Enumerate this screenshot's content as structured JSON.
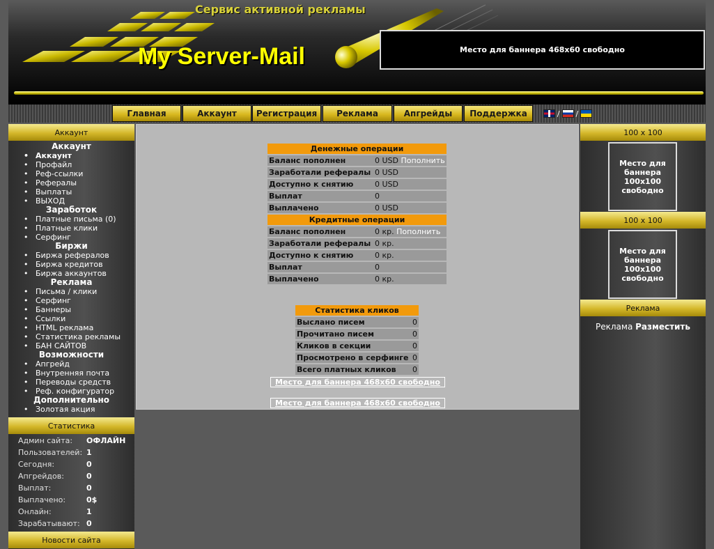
{
  "header": {
    "slogan": "Сервис активной рекламы",
    "site_title": "My Server-Mail",
    "banner_text": "Место для баннера 468х60 свободно"
  },
  "nav": {
    "items": [
      "Главная",
      "Аккаунт",
      "Регистрация",
      "Реклама",
      "Апгрейды",
      "Поддержка"
    ],
    "flag_separator": "/"
  },
  "left": {
    "account_title": "Аккаунт",
    "menu": [
      {
        "section": "Аккаунт",
        "items": [
          "Аккаунт",
          "Профайл",
          "Реф-ссылки",
          "Рефералы",
          "Выплаты",
          "ВЫХОД"
        ]
      },
      {
        "section": "Заработок",
        "items": [
          "Платные письма (0)",
          "Платные клики",
          "Серфинг"
        ]
      },
      {
        "section": "Биржи",
        "items": [
          "Биржа рефералов",
          "Биржа кредитов",
          "Биржа аккаунтов"
        ]
      },
      {
        "section": "Реклама",
        "items": [
          "Письма / клики",
          "Серфинг",
          "Баннеры",
          "Ссылки",
          "HTML реклама",
          "Статистика рекламы",
          "БАН САЙТОВ"
        ]
      },
      {
        "section": "Возможности",
        "items": [
          "Апгрейд",
          "Внутренняя почта",
          "Переводы средств",
          "Реф. конфигуратор"
        ]
      },
      {
        "section": "Дополнительно",
        "items": [
          "Золотая акция"
        ]
      }
    ],
    "stats_title": "Статистика",
    "stats": [
      {
        "label": "Админ сайта:",
        "value": "ОФЛАЙН"
      },
      {
        "label": "Пользователей:",
        "value": "1"
      },
      {
        "label": "Сегодня:",
        "value": "0"
      },
      {
        "label": "Апгрейдов:",
        "value": "0"
      },
      {
        "label": "Выплат:",
        "value": "0"
      },
      {
        "label": "Выплачено:",
        "value": "0$"
      },
      {
        "label": "Онлайн:",
        "value": "1"
      },
      {
        "label": "Зарабатывают:",
        "value": "0"
      }
    ],
    "news_title": "Новости сайта"
  },
  "money": {
    "title": "Денежные операции",
    "rows": [
      {
        "label": "Баланс пополнен",
        "value": "0 USD",
        "link": "Пополнить"
      },
      {
        "label": "Заработали рефералы",
        "value": "0 USD"
      },
      {
        "label": "Доступно к снятию",
        "value": "0 USD"
      },
      {
        "label": "Выплат",
        "value": "0"
      },
      {
        "label": "Выплачено",
        "value": "0 USD"
      }
    ]
  },
  "credit": {
    "title": "Кредитные операции",
    "rows": [
      {
        "label": "Баланс пополнен",
        "value": "0 кр.",
        "link": "Пополнить"
      },
      {
        "label": "Заработали рефералы",
        "value": "0 кр."
      },
      {
        "label": "Доступно к снятию",
        "value": "0 кр."
      },
      {
        "label": "Выплат",
        "value": "0"
      },
      {
        "label": "Выплачено",
        "value": "0 кр."
      }
    ]
  },
  "clicks": {
    "title": "Статистика кликов",
    "rows": [
      {
        "label": "Выслано писем",
        "value": "0"
      },
      {
        "label": "Прочитано писем",
        "value": "0"
      },
      {
        "label": "Кликов в секции",
        "value": "0"
      },
      {
        "label": "Просмотрено в серфинге",
        "value": "0"
      },
      {
        "label": "Всего платных кликов",
        "value": "0"
      }
    ]
  },
  "main_banners": [
    "Место для баннера 468х60 свободно",
    "Место для баннера 468х60 свободно"
  ],
  "right": {
    "blocks": [
      {
        "title": "100 x 100",
        "text": "Место для баннера 100х100 свободно"
      },
      {
        "title": "100 x 100",
        "text": "Место для баннера 100х100 свободно"
      }
    ],
    "ad_title": "Реклама",
    "ad_text": "Реклама",
    "ad_link": "Разместить"
  }
}
